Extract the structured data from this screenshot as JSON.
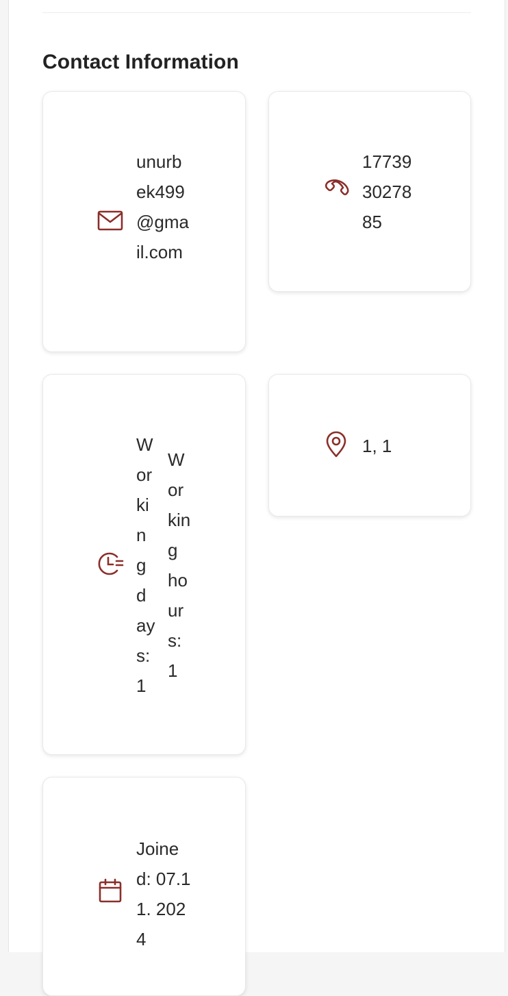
{
  "section": {
    "title": "Contact Information"
  },
  "contact": {
    "email": "unurbek499@gmail.com",
    "phone": "177393027885",
    "working_days": "Working days: 1",
    "working_hours": "Working hours: 1",
    "location": "1, 1",
    "joined": "Joined: 07.11. 2024"
  },
  "icons": {
    "email": "mail-icon",
    "phone": "phone-icon",
    "hours": "clock-icon",
    "location": "location-pin-icon",
    "joined": "calendar-icon"
  },
  "colors": {
    "accent": "#8b2e2a",
    "card_bg": "#ffffff",
    "page_bg": "#f5f5f5",
    "text": "#2a2a2a"
  }
}
